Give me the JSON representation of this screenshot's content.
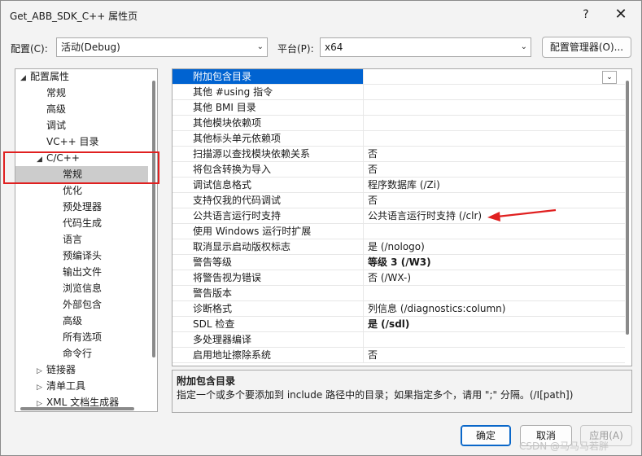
{
  "window": {
    "title": "Get_ABB_SDK_C++ 属性页",
    "help_label": "?",
    "close_label": "✕"
  },
  "config_bar": {
    "config_label": "配置(C):",
    "config_value": "活动(Debug)",
    "platform_label": "平台(P):",
    "platform_value": "x64",
    "manager_button": "配置管理器(O)..."
  },
  "tree": {
    "items": [
      {
        "label": "配置属性",
        "twisty": "◢",
        "level": 0
      },
      {
        "label": "常规",
        "twisty": "",
        "level": 1
      },
      {
        "label": "高级",
        "twisty": "",
        "level": 1
      },
      {
        "label": "调试",
        "twisty": "",
        "level": 1
      },
      {
        "label": "VC++ 目录",
        "twisty": "",
        "level": 1
      },
      {
        "label": "C/C++",
        "twisty": "◢",
        "level": 1
      },
      {
        "label": "常规",
        "twisty": "",
        "level": 2
      },
      {
        "label": "优化",
        "twisty": "",
        "level": 2
      },
      {
        "label": "预处理器",
        "twisty": "",
        "level": 2
      },
      {
        "label": "代码生成",
        "twisty": "",
        "level": 2
      },
      {
        "label": "语言",
        "twisty": "",
        "level": 2
      },
      {
        "label": "预编译头",
        "twisty": "",
        "level": 2
      },
      {
        "label": "输出文件",
        "twisty": "",
        "level": 2
      },
      {
        "label": "浏览信息",
        "twisty": "",
        "level": 2
      },
      {
        "label": "外部包含",
        "twisty": "",
        "level": 2
      },
      {
        "label": "高级",
        "twisty": "",
        "level": 2
      },
      {
        "label": "所有选项",
        "twisty": "",
        "level": 2
      },
      {
        "label": "命令行",
        "twisty": "",
        "level": 2
      },
      {
        "label": "链接器",
        "twisty": "▷",
        "level": 1
      },
      {
        "label": "清单工具",
        "twisty": "▷",
        "level": 1
      },
      {
        "label": "XML 文档生成器",
        "twisty": "▷",
        "level": 1
      }
    ],
    "selected_index": 6
  },
  "properties": [
    {
      "name": "附加包含目录",
      "value": ""
    },
    {
      "name": "其他 #using 指令",
      "value": ""
    },
    {
      "name": "其他 BMI 目录",
      "value": ""
    },
    {
      "name": "其他模块依赖项",
      "value": ""
    },
    {
      "name": "其他标头单元依赖项",
      "value": ""
    },
    {
      "name": "扫描源以查找模块依赖关系",
      "value": "否"
    },
    {
      "name": "将包含转换为导入",
      "value": "否"
    },
    {
      "name": "调试信息格式",
      "value": "程序数据库 (/Zi)"
    },
    {
      "name": "支持仅我的代码调试",
      "value": "否"
    },
    {
      "name": "公共语言运行时支持",
      "value": "公共语言运行时支持 (/clr)"
    },
    {
      "name": "使用 Windows 运行时扩展",
      "value": ""
    },
    {
      "name": "取消显示启动版权标志",
      "value": "是 (/nologo)"
    },
    {
      "name": "警告等级",
      "value": "等级 3 (/W3)",
      "bold": true
    },
    {
      "name": "将警告视为错误",
      "value": "否 (/WX-)"
    },
    {
      "name": "警告版本",
      "value": ""
    },
    {
      "name": "诊断格式",
      "value": "列信息 (/diagnostics:column)"
    },
    {
      "name": "SDL 检查",
      "value": "是 (/sdl)",
      "bold": true
    },
    {
      "name": "多处理器编译",
      "value": ""
    },
    {
      "name": "启用地址擦除系统",
      "value": "否"
    }
  ],
  "description": {
    "title": "附加包含目录",
    "text": "指定一个或多个要添加到 include 路径中的目录；如果指定多个，请用 \";\" 分隔。(/I[path])"
  },
  "buttons": {
    "ok": "确定",
    "cancel": "取消",
    "apply": "应用(A)"
  },
  "watermark": "CSDN @马马马若胖"
}
